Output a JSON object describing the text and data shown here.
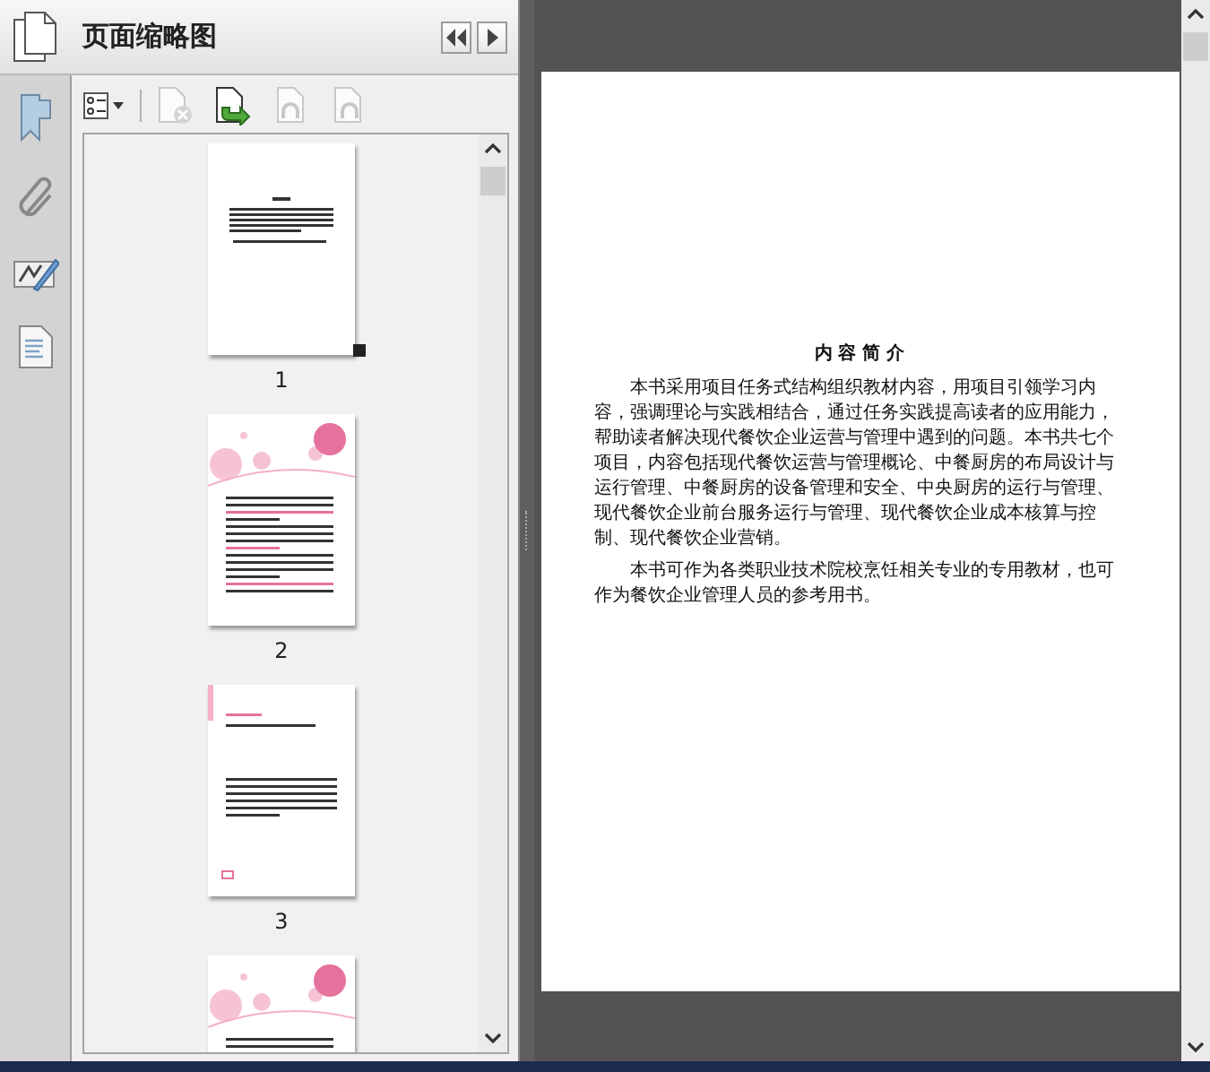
{
  "panel": {
    "title": "页面缩略图"
  },
  "toolbar": [
    {
      "kind": "options",
      "disabled": false
    },
    {
      "kind": "delete",
      "disabled": true
    },
    {
      "kind": "insert",
      "disabled": false
    },
    {
      "kind": "rotate-left",
      "disabled": true
    },
    {
      "kind": "rotate-right",
      "disabled": true
    }
  ],
  "thumbnails": [
    {
      "kind": "text",
      "label": "1",
      "selected": true
    },
    {
      "kind": "pink",
      "label": "2",
      "selected": false
    },
    {
      "kind": "plain",
      "label": "3",
      "selected": false
    },
    {
      "kind": "pink",
      "selected": false
    }
  ],
  "document": {
    "heading": "内 容 简 介",
    "paragraphs": [
      "本书采用项目任务式结构组织教材内容，用项目引领学习内容，强调理论与实践相结合，通过任务实践提高读者的应用能力，帮助读者解决现代餐饮企业运营与管理中遇到的问题。本书共七个项目，内容包括现代餐饮运营与管理概论、中餐厨房的布局设计与运行管理、中餐厨房的设备管理和安全、中央厨房的运行与管理、现代餐饮企业前台服务运行与管理、现代餐饮企业成本核算与控制、现代餐饮企业营销。",
      "本书可作为各类职业技术院校烹饪相关专业的专用教材，也可作为餐饮企业管理人员的参考用书。"
    ]
  }
}
